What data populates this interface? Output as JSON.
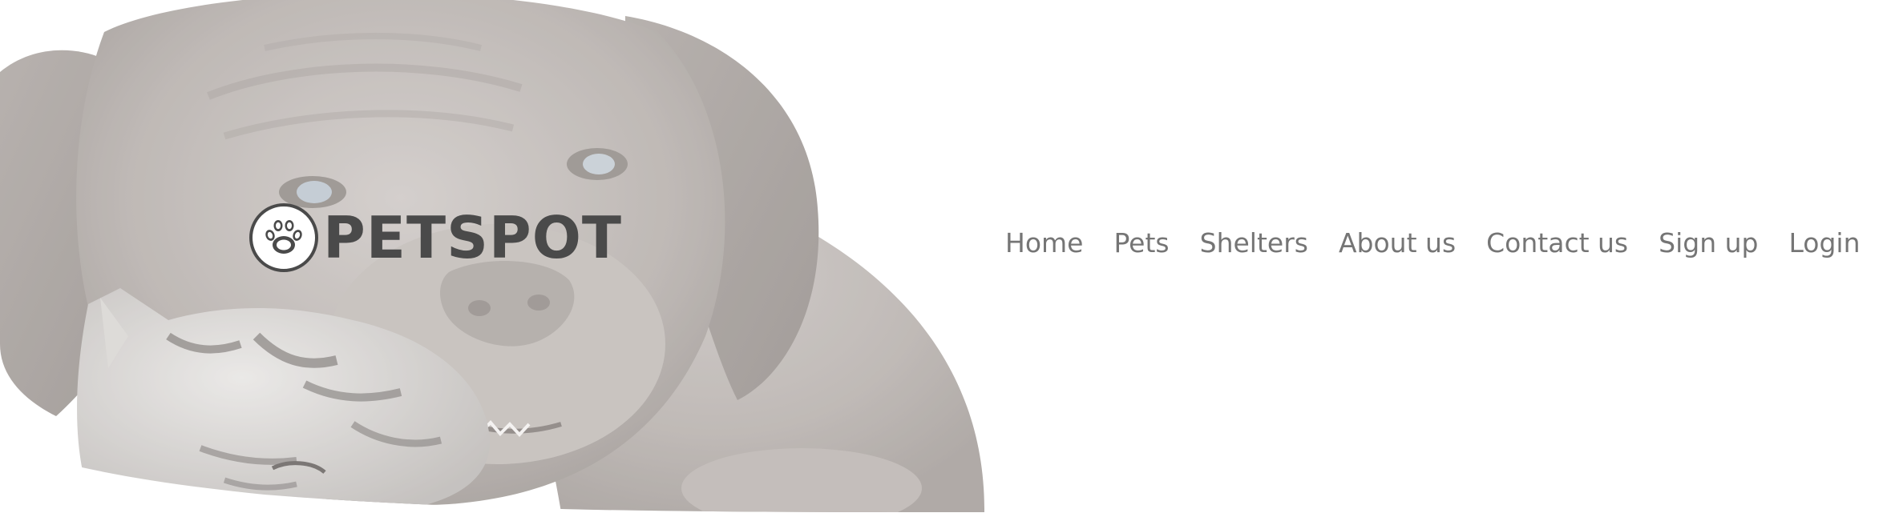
{
  "brand": {
    "name": "PETSPOT",
    "logo_icon": "paw-icon"
  },
  "hero": {
    "image": "puppy-and-kitten-photo"
  },
  "nav": {
    "items": [
      {
        "label": "Home"
      },
      {
        "label": "Pets"
      },
      {
        "label": "Shelters"
      },
      {
        "label": "About us"
      },
      {
        "label": "Contact us"
      },
      {
        "label": "Sign up"
      },
      {
        "label": "Login"
      }
    ]
  },
  "colors": {
    "brand_text": "#4a4a4a",
    "nav_text": "#757575",
    "background": "#ffffff"
  }
}
